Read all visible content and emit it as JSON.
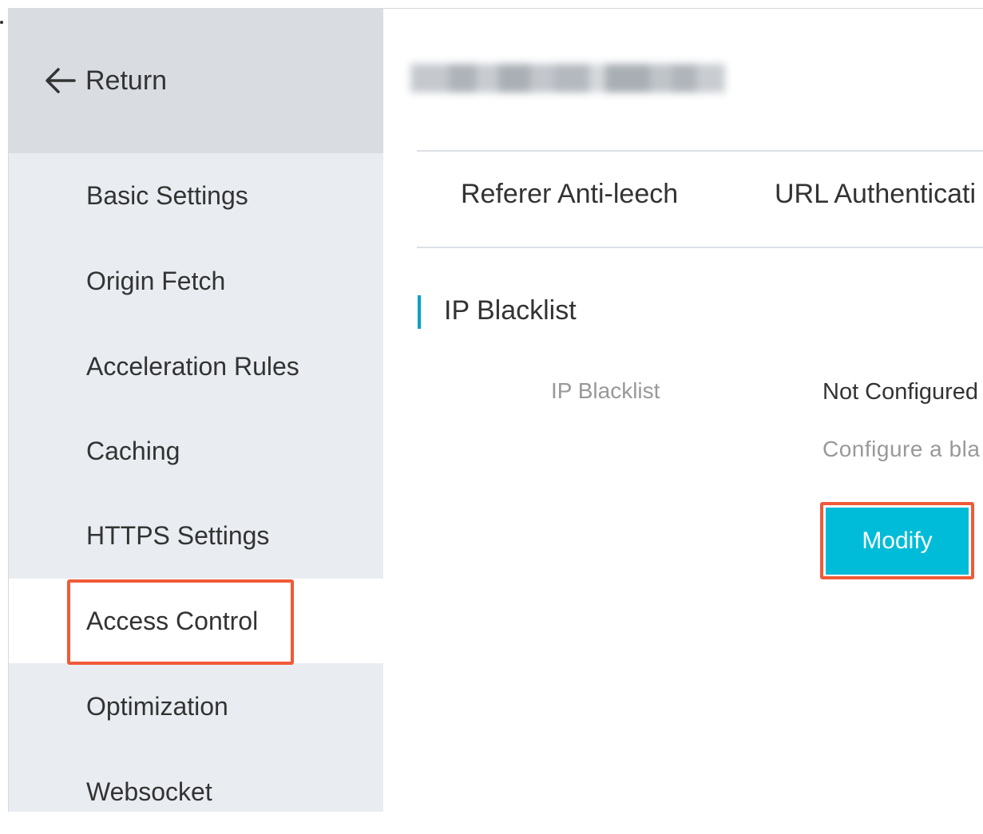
{
  "sidebar": {
    "return_label": "Return",
    "items": [
      {
        "label": "Basic Settings"
      },
      {
        "label": "Origin Fetch"
      },
      {
        "label": "Acceleration Rules"
      },
      {
        "label": "Caching"
      },
      {
        "label": "HTTPS Settings"
      },
      {
        "label": "Access Control",
        "active": true
      },
      {
        "label": "Optimization"
      },
      {
        "label": "Websocket"
      }
    ]
  },
  "main": {
    "tabs": [
      {
        "label": "Referer Anti-leech"
      },
      {
        "label": "URL Authenticati"
      }
    ],
    "section_title": "IP Blacklist",
    "field": {
      "label": "IP Blacklist",
      "value": "Not Configured",
      "hint": "Configure a bla"
    },
    "modify_button": "Modify"
  },
  "colors": {
    "accent": "#00bcd8",
    "section_marker": "#00a2ca",
    "highlight": "#f05a38",
    "sidebar_bg": "#e9edf1",
    "return_bg": "#d9dde2"
  },
  "icons": {
    "return": "arrow-left-icon"
  }
}
